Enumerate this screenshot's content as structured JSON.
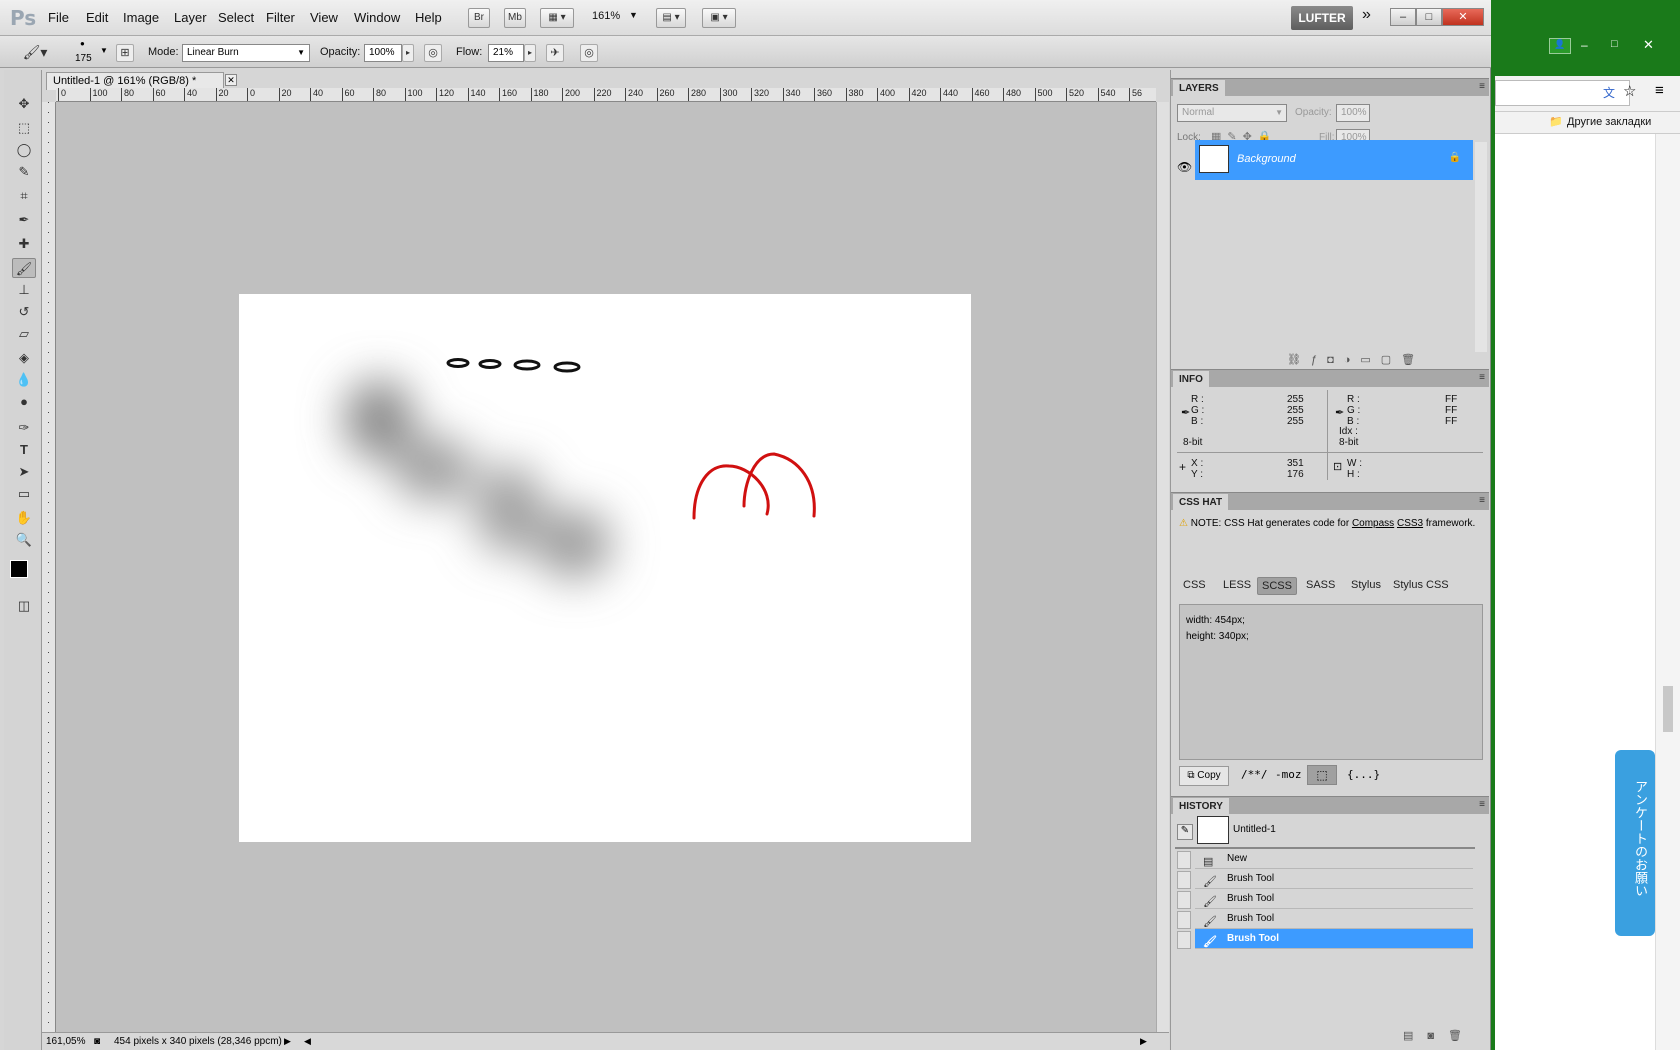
{
  "app": {
    "logo": "Ps",
    "workspace": "LUFTER"
  },
  "menu": [
    "File",
    "Edit",
    "Image",
    "Layer",
    "Select",
    "Filter",
    "View",
    "Window",
    "Help"
  ],
  "menubar_buttons": {
    "br": "Br",
    "mb": "Mb",
    "zoom": "161%"
  },
  "options": {
    "brush_size": "175",
    "mode_label": "Mode:",
    "mode_value": "Linear Burn",
    "opacity_label": "Opacity:",
    "opacity_value": "100%",
    "flow_label": "Flow:",
    "flow_value": "21%"
  },
  "document": {
    "tab_title": "Untitled-1 @ 161% (RGB/8) *"
  },
  "ruler_h": [
    "0",
    "100",
    "80",
    "60",
    "40",
    "20",
    "0",
    "20",
    "40",
    "60",
    "80",
    "100",
    "120",
    "140",
    "160",
    "180",
    "200",
    "220",
    "240",
    "260",
    "280",
    "300",
    "320",
    "340",
    "360",
    "380",
    "400",
    "420",
    "440",
    "460",
    "480",
    "500",
    "520",
    "540",
    "56"
  ],
  "status": {
    "zoom": "161,05%",
    "info": "454 pixels x 340 pixels (28,346 ppcm)"
  },
  "layers": {
    "tab": "LAYERS",
    "blend": "Normal",
    "opacity_label": "Opacity:",
    "opacity_value": "100%",
    "lock_label": "Lock:",
    "fill_label": "Fill:",
    "fill_value": "100%",
    "layer_name": "Background"
  },
  "info": {
    "tab": "INFO",
    "r1": "255",
    "g1": "255",
    "b1": "255",
    "r2": "FF",
    "g2": "FF",
    "b2": "FF",
    "bit1": "8-bit",
    "bit2": "8-bit",
    "idx": "Idx :",
    "x": "351",
    "y": "176",
    "r_label": "R :",
    "g_label": "G :",
    "b_label": "B :",
    "x_label": "X :",
    "y_label": "Y :",
    "w_label": "W :",
    "h_label": "H :"
  },
  "csshat": {
    "tab": "CSS HAT",
    "note": "NOTE: CSS Hat generates code for",
    "compass": "Compass",
    "css3": "CSS3",
    "framework": "framework.",
    "tabs": [
      "CSS",
      "LESS",
      "SCSS",
      "SASS",
      "Stylus",
      "Stylus CSS"
    ],
    "code_line1": "width: 454px;",
    "code_line2": "height: 340px;",
    "copy": "Copy",
    "comment": "/**/",
    "moz": "-moz",
    "braces": "{...}"
  },
  "history": {
    "tab": "HISTORY",
    "snapshot": "Untitled-1",
    "items": [
      "New",
      "Brush Tool",
      "Brush Tool",
      "Brush Tool",
      "Brush Tool"
    ]
  },
  "browser": {
    "bookmarks": "Другие закладки",
    "survey": "アンケートのお願い"
  },
  "colors": {
    "accent": "#3d9bff",
    "stroke_red": "#d01010"
  }
}
